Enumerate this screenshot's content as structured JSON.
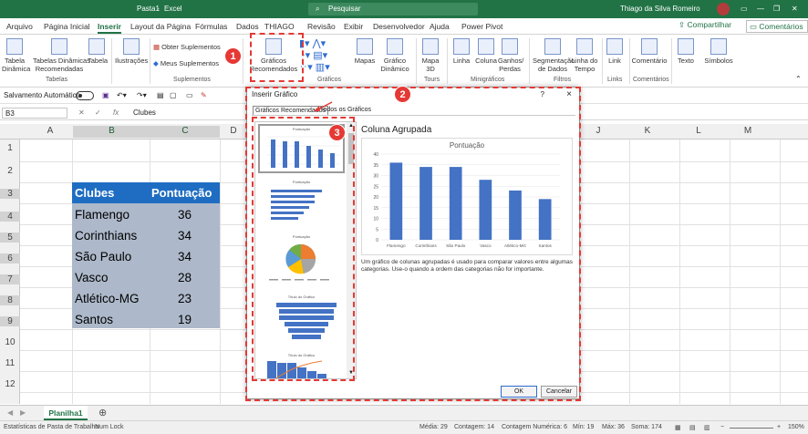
{
  "titlebar": {
    "doc": "Pasta1",
    "app": "Excel",
    "search": "Pesquisar",
    "user": "Thiago da Silva Romeiro"
  },
  "menu": {
    "tabs": [
      "Arquivo",
      "Página Inicial",
      "Inserir",
      "Layout da Página",
      "Fórmulas",
      "Dados",
      "THIAGO",
      "Revisão",
      "Exibir",
      "Desenvolvedor",
      "Ajuda",
      "Power Pivot"
    ],
    "active": "Inserir",
    "share": "Compartilhar",
    "comments": "Comentários"
  },
  "ribbon": {
    "tabela_dinamica": "Tabela\nDinâmica",
    "tabelas_dinamicas_rec": "Tabelas Dinâmicas\nRecomendadas",
    "tabela": "Tabela",
    "ilustracoes": "Ilustrações",
    "obter_suplementos": "Obter Suplementos",
    "meus_suplementos": "Meus Suplementos",
    "graficos_rec": "Gráficos\nRecomendados",
    "mapas": "Mapas",
    "grafico_dinamico": "Gráfico\nDinâmico",
    "mapa3d": "Mapa\n3D",
    "linha": "Linha",
    "coluna": "Coluna",
    "ganhos_perdas": "Ganhos/\nPerdas",
    "segmentacao": "Segmentação\nde Dados",
    "linha_tempo": "Linha do\nTempo",
    "link": "Link",
    "comentario": "Comentário",
    "texto": "Texto",
    "simbolos": "Símbolos",
    "groups": {
      "tabelas": "Tabelas",
      "suplementos": "Suplementos",
      "graficos": "Gráficos",
      "tours": "Tours",
      "minigraficos": "Minigráficos",
      "filtros": "Filtros",
      "links": "Links",
      "comentarios": "Comentários"
    }
  },
  "qat": {
    "autosave": "Salvamento Automático"
  },
  "formula": {
    "cell": "B3",
    "value": "Clubes",
    "fx": "fx"
  },
  "columns": [
    "A",
    "B",
    "C",
    "D",
    "J",
    "K",
    "L",
    "M"
  ],
  "rows": [
    "1",
    "2",
    "3",
    "4",
    "5",
    "6",
    "7",
    "8",
    "9",
    "10",
    "11",
    "12"
  ],
  "table": {
    "headers": [
      "Clubes",
      "Pontuação"
    ],
    "rows": [
      [
        "Flamengo",
        "36"
      ],
      [
        "Corinthians",
        "34"
      ],
      [
        "São Paulo",
        "34"
      ],
      [
        "Vasco",
        "28"
      ],
      [
        "Atlético-MG",
        "23"
      ],
      [
        "Santos",
        "19"
      ]
    ]
  },
  "sheet": {
    "name": "Planilha1"
  },
  "status": {
    "left": "Estatísticas de Pasta de Trabalho",
    "numlock": "Num Lock",
    "media": "Média: 29",
    "contagem": "Contagem: 14",
    "contagem_num": "Contagem Numérica: 6",
    "min": "Mín: 19",
    "max": "Máx: 36",
    "soma": "Soma: 174",
    "zoom": "150%"
  },
  "dialog": {
    "title": "Inserir Gráfico",
    "help": "?",
    "close": "×",
    "tab_recomendados": "Gráficos Recomendados",
    "tab_todos": "Todos os Gráficos",
    "preview_title": "Coluna Agrupada",
    "description": "Um gráfico de colunas agrupadas é usado para comparar valores entre algumas categorias. Use-o quando a ordem das categorias não for importante.",
    "ok": "OK",
    "cancel": "Cancelar",
    "thumb_titles": [
      "Pontuação",
      "Pontuação",
      "Pontuação",
      "Título do Gráfico",
      "Título do Gráfico"
    ]
  },
  "annotations": {
    "b1": "1",
    "b2": "2",
    "b3": "3",
    "color": "#e53935"
  },
  "chart_data": {
    "type": "bar",
    "title": "Pontuação",
    "categories": [
      "Flamengo",
      "Corinthians",
      "São Paulo",
      "Vasco",
      "Atlético-MG",
      "Santos"
    ],
    "values": [
      36,
      34,
      34,
      28,
      23,
      19
    ],
    "ylim": [
      0,
      40
    ],
    "yticks": [
      "0",
      "5",
      "10",
      "15",
      "20",
      "25",
      "30",
      "35",
      "40"
    ],
    "grid": true,
    "color": "#4472c4"
  }
}
